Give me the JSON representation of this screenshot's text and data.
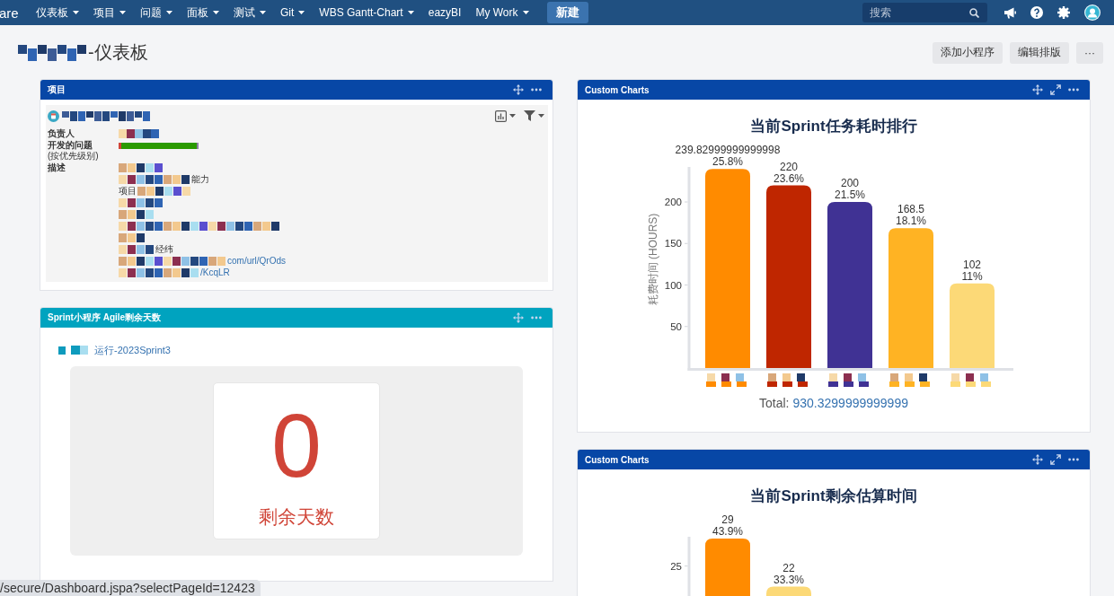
{
  "nav": {
    "logo_text": "are",
    "items": [
      {
        "label": "仪表板",
        "dropdown": true
      },
      {
        "label": "项目",
        "dropdown": true
      },
      {
        "label": "问题",
        "dropdown": true
      },
      {
        "label": "面板",
        "dropdown": true
      },
      {
        "label": "测试",
        "dropdown": true
      },
      {
        "label": "Git",
        "dropdown": true
      },
      {
        "label": "WBS Gantt-Chart",
        "dropdown": true
      },
      {
        "label": "eazyBI",
        "dropdown": false
      },
      {
        "label": "My Work",
        "dropdown": true
      }
    ],
    "create_button": "新建",
    "search": {
      "placeholder": "搜索"
    }
  },
  "page_header": {
    "title": "-仪表板",
    "buttons": [
      "添加小程序",
      "编辑排版",
      "···"
    ]
  },
  "left_column": [
    {
      "kind": "project",
      "title": "项目",
      "color": "#0747a6",
      "fields": [
        {
          "kind": "redacted",
          "label": "负责人"
        },
        {
          "kind": "bar",
          "label": "开发的问题",
          "note": "(按优先级别)",
          "segments": [
            {
              "color": "#d04437",
              "level": 0.03
            },
            {
              "color": "#2a9a00",
              "level": 0.95
            },
            {
              "color": "#8d7fa3",
              "level": 0.02
            }
          ]
        },
        {
          "kind": "lines",
          "label": "描述",
          "lines": [
            {
              "parts": [
                {
                  "kind": "redacted"
                }
              ]
            },
            {
              "parts": [
                {
                  "kind": "redacted"
                },
                {
                  "kind": "text",
                  "text": "能力"
                }
              ]
            },
            {
              "parts": [
                {
                  "kind": "text",
                  "text": "项目"
                },
                {
                  "kind": "redacted"
                }
              ]
            },
            {
              "parts": [
                {
                  "kind": "redacted"
                }
              ]
            },
            {
              "parts": [
                {
                  "kind": "redacted"
                }
              ]
            },
            {
              "parts": [
                {
                  "kind": "redacted"
                }
              ]
            },
            {
              "parts": [
                {
                  "kind": "redacted"
                }
              ]
            },
            {
              "parts": [
                {
                  "kind": "redacted"
                },
                {
                  "kind": "text",
                  "text": "经纬"
                }
              ]
            },
            {
              "parts": [
                {
                  "kind": "redacted"
                },
                {
                  "kind": "link",
                  "text": "com/url/QrOds"
                }
              ]
            },
            {
              "parts": [
                {
                  "kind": "redacted"
                },
                {
                  "kind": "link",
                  "text": "/KcqLR"
                }
              ]
            }
          ]
        }
      ]
    },
    {
      "kind": "sprint",
      "title": "Sprint小程序 Agile剩余天数",
      "color": "#00a3bf",
      "sprint_link": "运行-2023Sprint3",
      "days": "0",
      "days_label": "剩余天数"
    }
  ],
  "right_column": [
    {
      "kind": "chart",
      "title": "Custom Charts",
      "color": "#0747a6",
      "chart_data": {
        "type": "bar",
        "title": "当前Sprint任务耗时排行",
        "ylabel": "耗费时间 (HOURS)",
        "values": [
          239.83,
          220,
          200,
          168.5,
          102
        ],
        "colors": [
          "#ff8b00",
          "#bf2600",
          "#403294",
          "#ffb323",
          "#fcd977"
        ],
        "ylim": [
          0,
          240
        ],
        "yticks": [
          50,
          100,
          150,
          200
        ],
        "value_labels": [
          [
            "239.82999999999998",
            "25.8%"
          ],
          [
            "220",
            "23.6%"
          ],
          [
            "200",
            "21.5%"
          ],
          [
            "168.5",
            "18.1%"
          ],
          [
            "102",
            "11%"
          ]
        ]
      },
      "total_label": "Total:",
      "total_value": "930.3299999999999"
    },
    {
      "kind": "chart",
      "title": "Custom Charts",
      "color": "#0747a6",
      "chart_data": {
        "type": "bar",
        "title": "当前Sprint剩余估算时间",
        "values": [
          29,
          22
        ],
        "colors": [
          "#ff8b00",
          "#fcd977"
        ],
        "ylim": [
          0,
          29
        ],
        "yticks": [
          25
        ],
        "value_labels": [
          [
            "29",
            "43.9%"
          ],
          [
            "22",
            "33.3%"
          ]
        ]
      }
    }
  ],
  "status_url": "/secure/Dashboard.jspa?selectPageId=12423"
}
